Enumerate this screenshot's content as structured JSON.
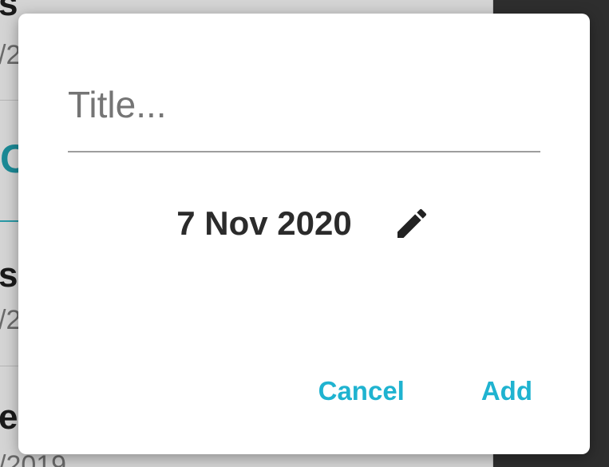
{
  "background": {
    "items": [
      {
        "title": "s",
        "subtitle": "/2"
      },
      {
        "title": "s",
        "subtitle": "/2"
      },
      {
        "title": "e",
        "subtitle": "/2019"
      }
    ],
    "accent_char": "C",
    "accent_color": "#1b8a96"
  },
  "dialog": {
    "title_placeholder": "Title...",
    "title_value": "",
    "date": "7 Nov 2020",
    "edit_icon": "pencil-icon",
    "cancel_label": "Cancel",
    "add_label": "Add",
    "accent_color": "#1fb3d0"
  }
}
